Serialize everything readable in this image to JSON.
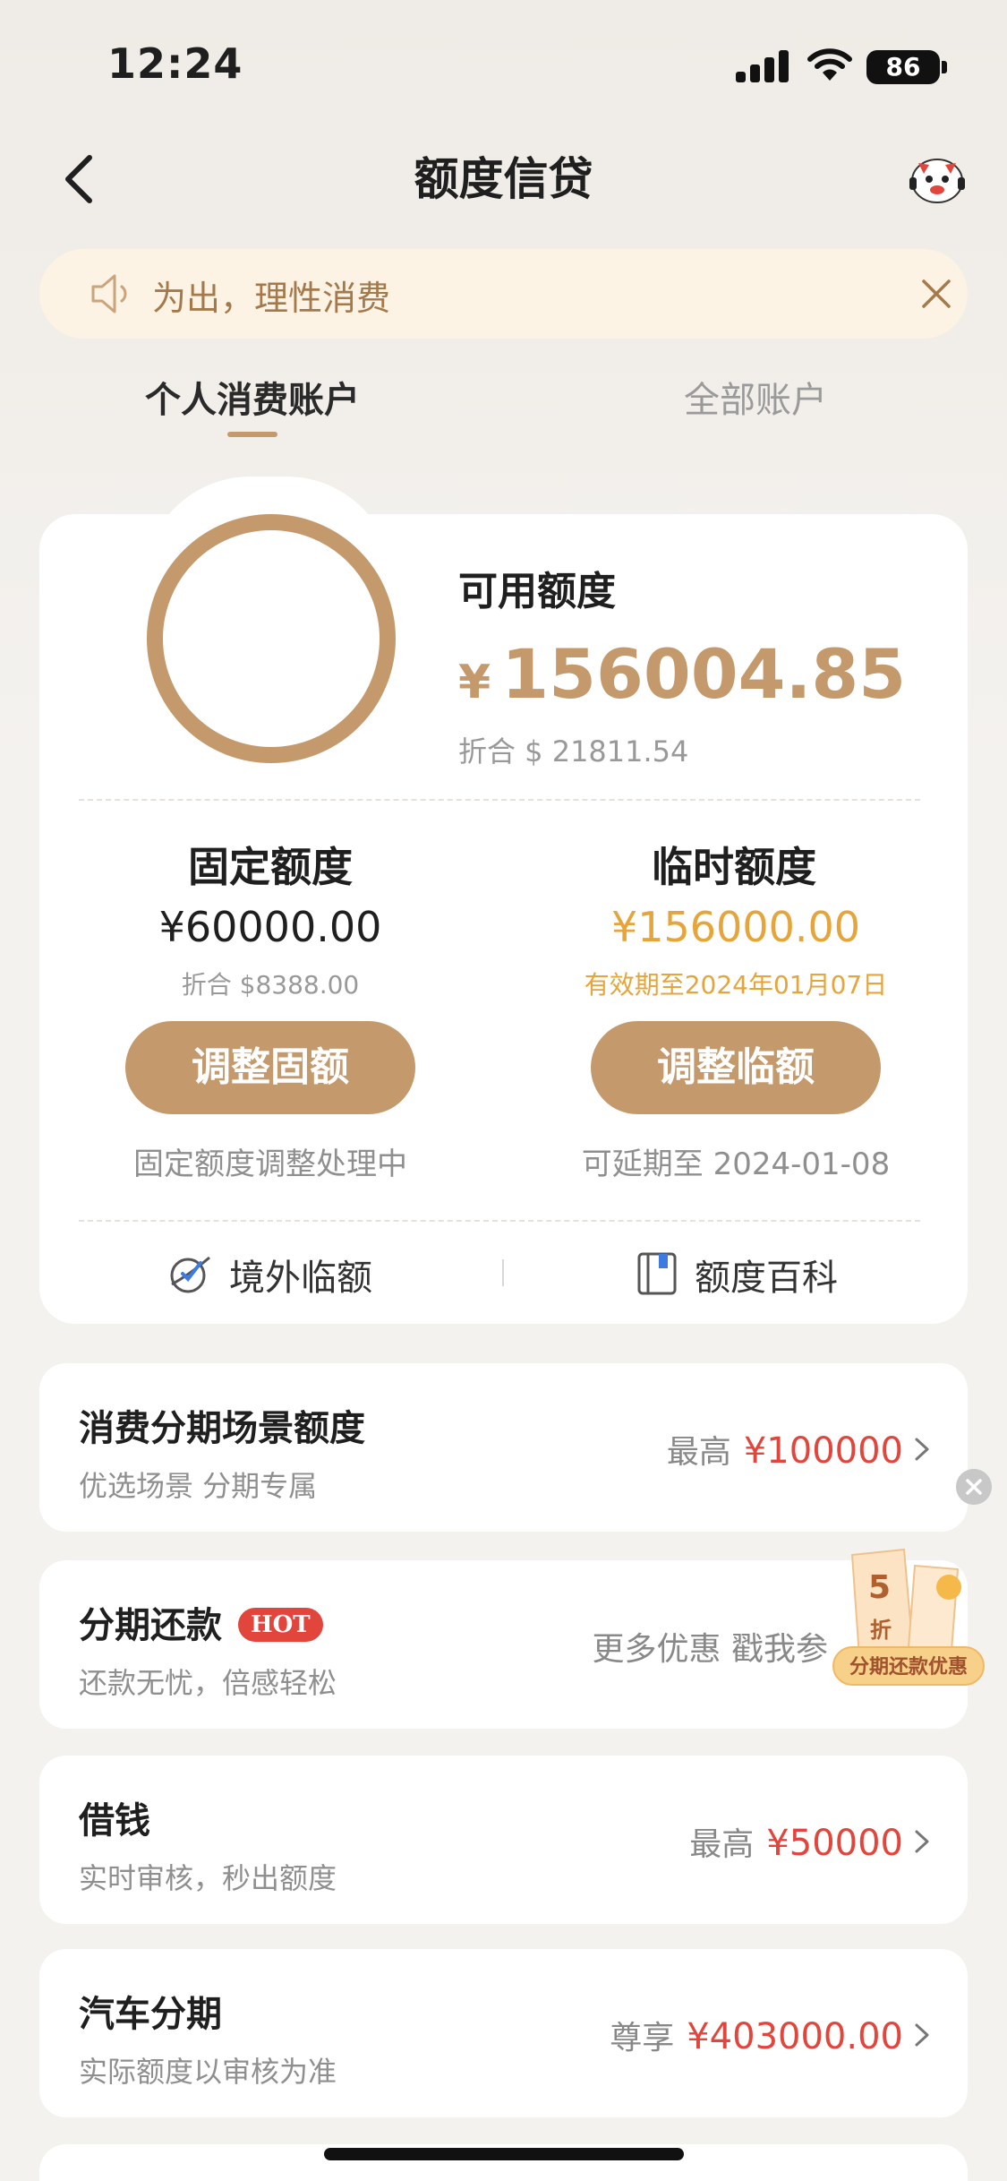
{
  "status_bar": {
    "time": "12:24",
    "battery": "86"
  },
  "nav": {
    "title": "额度信贷"
  },
  "notice": {
    "text": "为出，理性消费"
  },
  "tabs": [
    {
      "label": "个人消费账户"
    },
    {
      "label": "全部账户"
    }
  ],
  "summary": {
    "available_label": "可用额度",
    "currency": "¥",
    "available_amount": "156004.85",
    "available_usd": "折合 $ 21811.54"
  },
  "fixed": {
    "title": "固定额度",
    "amount": "¥60000.00",
    "usd": "折合 $8388.00",
    "button": "调整固额",
    "status": "固定额度调整处理中"
  },
  "temporary": {
    "title": "临时额度",
    "amount": "¥156000.00",
    "validity": "有效期至2024年01月07日",
    "button": "调整临额",
    "status": "可延期至 2024-01-08"
  },
  "links": [
    {
      "label": "境外临额"
    },
    {
      "label": "额度百科"
    }
  ],
  "list": [
    {
      "title": "消费分期场景额度",
      "subtitle": "优选场景 分期专属",
      "right_prefix": "最高",
      "right_value": "¥100000"
    },
    {
      "title": "分期还款",
      "badge": "HOT",
      "subtitle": "还款无忧，倍感轻松",
      "right_prefix": "更多优惠 戳我参",
      "right_value": ""
    },
    {
      "title": "借钱",
      "subtitle": "实时审核，秒出额度",
      "right_prefix": "最高",
      "right_value": "¥50000"
    },
    {
      "title": "汽车分期",
      "subtitle": "实际额度以审核为准",
      "right_prefix": "尊享",
      "right_value": "¥403000.00"
    }
  ],
  "promo": {
    "digit": "5",
    "unit": "折",
    "tag": "分期还款优惠"
  },
  "colors": {
    "accent": "#c49a6c",
    "red": "#e2453c",
    "temp_gold": "#e5a53a",
    "notice_bg": "#fcf3e4"
  }
}
